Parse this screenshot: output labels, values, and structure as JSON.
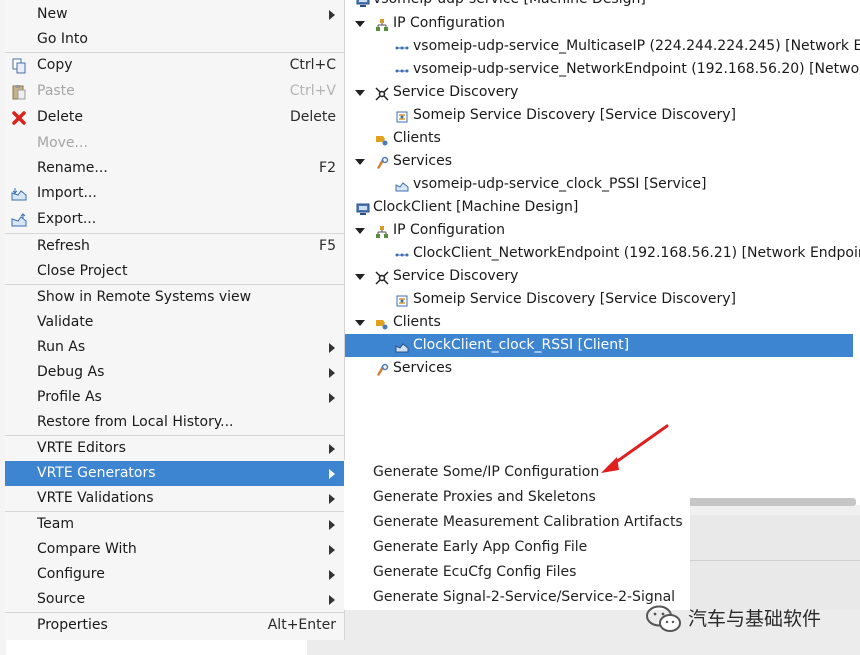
{
  "tree": {
    "rows": [
      {
        "label": "vsomeip-udp-service [Machine Design]",
        "icon": "machine-design-icon"
      },
      {
        "label": "IP Configuration",
        "icon": "ip-configuration-icon"
      },
      {
        "label": "vsomeip-udp-service_MulticaseIP (224.244.224.245)  [Network Ei",
        "icon": "network-endpoint-icon"
      },
      {
        "label": "vsomeip-udp-service_NetworkEndpoint (192.168.56.20)  [Networ",
        "icon": "network-endpoint-icon"
      },
      {
        "label": "Service Discovery",
        "icon": "service-discovery-icon"
      },
      {
        "label": "Someip Service Discovery [Service Discovery]",
        "icon": "someip-sd-icon"
      },
      {
        "label": "Clients",
        "icon": "clients-icon"
      },
      {
        "label": "Services",
        "icon": "services-icon"
      },
      {
        "label": "vsomeip-udp-service_clock_PSSI [Service]",
        "icon": "service-instance-icon"
      },
      {
        "label": "ClockClient [Machine Design]",
        "icon": "machine-design-icon"
      },
      {
        "label": "IP Configuration",
        "icon": "ip-configuration-icon"
      },
      {
        "label": "ClockClient_NetworkEndpoint (192.168.56.21)  [Network Endpoint",
        "icon": "network-endpoint-icon"
      },
      {
        "label": "Service Discovery",
        "icon": "service-discovery-icon"
      },
      {
        "label": "Someip Service Discovery [Service Discovery]",
        "icon": "someip-sd-icon"
      },
      {
        "label": "Clients",
        "icon": "clients-icon"
      },
      {
        "label": "ClockClient_clock_RSSI [Client]",
        "icon": "client-instance-icon"
      },
      {
        "label": "Services",
        "icon": "services-icon"
      }
    ]
  },
  "menu": {
    "items": [
      {
        "label": "New",
        "shortcut": "",
        "submenu": true
      },
      {
        "label": "Go Into",
        "shortcut": ""
      },
      {
        "label": "Copy",
        "shortcut": "Ctrl+C",
        "icon": "copy-icon"
      },
      {
        "label": "Paste",
        "shortcut": "Ctrl+V",
        "icon": "paste-icon",
        "disabled": true
      },
      {
        "label": "Delete",
        "shortcut": "Delete",
        "icon": "delete-icon"
      },
      {
        "label": "Move...",
        "shortcut": "",
        "disabled": true
      },
      {
        "label": "Rename...",
        "shortcut": "F2"
      },
      {
        "label": "Import...",
        "shortcut": "",
        "icon": "import-icon"
      },
      {
        "label": "Export...",
        "shortcut": "",
        "icon": "export-icon"
      },
      {
        "label": "Refresh",
        "shortcut": "F5"
      },
      {
        "label": "Close Project",
        "shortcut": ""
      },
      {
        "label": "Show in Remote Systems view",
        "shortcut": ""
      },
      {
        "label": "Validate",
        "shortcut": ""
      },
      {
        "label": "Run As",
        "shortcut": "",
        "submenu": true
      },
      {
        "label": "Debug As",
        "shortcut": "",
        "submenu": true
      },
      {
        "label": "Profile As",
        "shortcut": "",
        "submenu": true
      },
      {
        "label": "Restore from Local History...",
        "shortcut": ""
      },
      {
        "label": "VRTE Editors",
        "shortcut": "",
        "submenu": true
      },
      {
        "label": "VRTE Generators",
        "shortcut": "",
        "submenu": true,
        "active": true
      },
      {
        "label": "VRTE Validations",
        "shortcut": "",
        "submenu": true
      },
      {
        "label": "Team",
        "shortcut": "",
        "submenu": true
      },
      {
        "label": "Compare With",
        "shortcut": "",
        "submenu": true
      },
      {
        "label": "Configure",
        "shortcut": "",
        "submenu": true
      },
      {
        "label": "Source",
        "shortcut": "",
        "submenu": true
      },
      {
        "label": "Properties",
        "shortcut": "Alt+Enter"
      }
    ]
  },
  "submenu": {
    "items": [
      "Generate Some/IP Configuration",
      "Generate Proxies and Skeletons",
      "Generate Measurement Calibration Artifacts",
      "Generate Early App Config File",
      "Generate EcuCfg Config Files",
      "Generate Signal-2-Service/Service-2-Signal"
    ]
  },
  "watermark": {
    "text": "汽车与基础软件",
    "icon": "wechat-icon"
  },
  "colors": {
    "selection": "#3d84d1",
    "annotation_arrow": "#e02020"
  }
}
